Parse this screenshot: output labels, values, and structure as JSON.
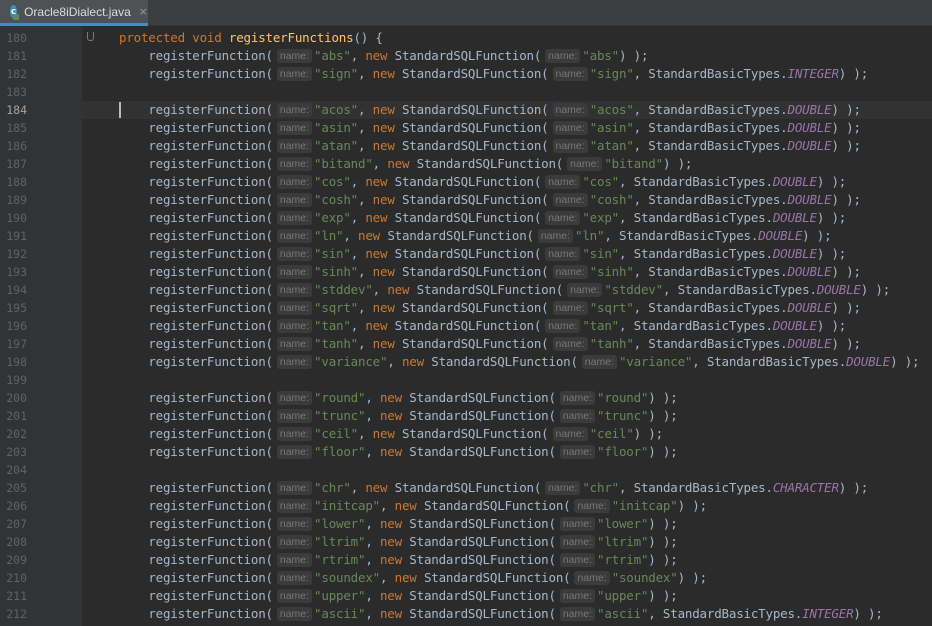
{
  "tab": {
    "icon_letter": "c",
    "title": "Oracle8iDialect.java",
    "close_glyph": "×"
  },
  "hint_label": "name:",
  "method_header": {
    "line_number": "180",
    "modifier": "protected",
    "return_type": "void",
    "name": "registerFunctions",
    "suffix": "() {"
  },
  "call_name": "registerFunction",
  "class_name": "StandardSQLFunction",
  "types_class": "StandardBasicTypes",
  "current_line": "184",
  "lines": [
    {
      "n": "181",
      "name": "\"abs\"",
      "arg": "\"abs\"",
      "type": ""
    },
    {
      "n": "182",
      "name": "\"sign\"",
      "arg": "\"sign\"",
      "type": "INTEGER"
    },
    {
      "n": "183",
      "blank": true
    },
    {
      "n": "184",
      "name": "\"acos\"",
      "arg": "\"acos\"",
      "type": "DOUBLE"
    },
    {
      "n": "185",
      "name": "\"asin\"",
      "arg": "\"asin\"",
      "type": "DOUBLE"
    },
    {
      "n": "186",
      "name": "\"atan\"",
      "arg": "\"atan\"",
      "type": "DOUBLE"
    },
    {
      "n": "187",
      "name": "\"bitand\"",
      "arg": "\"bitand\"",
      "type": ""
    },
    {
      "n": "188",
      "name": "\"cos\"",
      "arg": "\"cos\"",
      "type": "DOUBLE"
    },
    {
      "n": "189",
      "name": "\"cosh\"",
      "arg": "\"cosh\"",
      "type": "DOUBLE"
    },
    {
      "n": "190",
      "name": "\"exp\"",
      "arg": "\"exp\"",
      "type": "DOUBLE"
    },
    {
      "n": "191",
      "name": "\"ln\"",
      "arg": "\"ln\"",
      "type": "DOUBLE"
    },
    {
      "n": "192",
      "name": "\"sin\"",
      "arg": "\"sin\"",
      "type": "DOUBLE"
    },
    {
      "n": "193",
      "name": "\"sinh\"",
      "arg": "\"sinh\"",
      "type": "DOUBLE"
    },
    {
      "n": "194",
      "name": "\"stddev\"",
      "arg": "\"stddev\"",
      "type": "DOUBLE"
    },
    {
      "n": "195",
      "name": "\"sqrt\"",
      "arg": "\"sqrt\"",
      "type": "DOUBLE"
    },
    {
      "n": "196",
      "name": "\"tan\"",
      "arg": "\"tan\"",
      "type": "DOUBLE"
    },
    {
      "n": "197",
      "name": "\"tanh\"",
      "arg": "\"tanh\"",
      "type": "DOUBLE"
    },
    {
      "n": "198",
      "name": "\"variance\"",
      "arg": "\"variance\"",
      "type": "DOUBLE"
    },
    {
      "n": "199",
      "blank": true
    },
    {
      "n": "200",
      "name": "\"round\"",
      "arg": "\"round\"",
      "type": ""
    },
    {
      "n": "201",
      "name": "\"trunc\"",
      "arg": "\"trunc\"",
      "type": ""
    },
    {
      "n": "202",
      "name": "\"ceil\"",
      "arg": "\"ceil\"",
      "type": ""
    },
    {
      "n": "203",
      "name": "\"floor\"",
      "arg": "\"floor\"",
      "type": ""
    },
    {
      "n": "204",
      "blank": true
    },
    {
      "n": "205",
      "name": "\"chr\"",
      "arg": "\"chr\"",
      "type": "CHARACTER"
    },
    {
      "n": "206",
      "name": "\"initcap\"",
      "arg": "\"initcap\"",
      "type": ""
    },
    {
      "n": "207",
      "name": "\"lower\"",
      "arg": "\"lower\"",
      "type": ""
    },
    {
      "n": "208",
      "name": "\"ltrim\"",
      "arg": "\"ltrim\"",
      "type": ""
    },
    {
      "n": "209",
      "name": "\"rtrim\"",
      "arg": "\"rtrim\"",
      "type": ""
    },
    {
      "n": "210",
      "name": "\"soundex\"",
      "arg": "\"soundex\"",
      "type": ""
    },
    {
      "n": "211",
      "name": "\"upper\"",
      "arg": "\"upper\"",
      "type": ""
    },
    {
      "n": "212",
      "name": "\"ascii\"",
      "arg": "\"ascii\"",
      "type": "INTEGER"
    }
  ],
  "colors": {
    "background": "#2b2b2b",
    "gutter": "#313335",
    "keyword": "#cc7832",
    "method": "#ffc66d",
    "string": "#6a8759",
    "constant": "#9876aa",
    "text": "#a9b7c6"
  }
}
